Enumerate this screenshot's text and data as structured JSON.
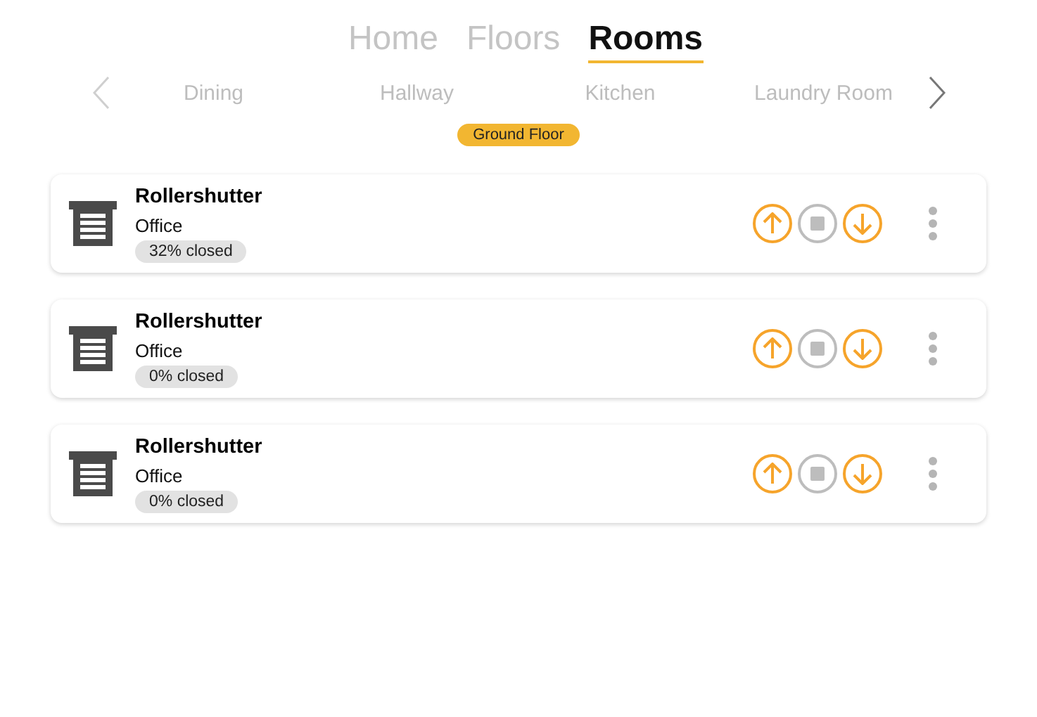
{
  "nav_tabs": [
    {
      "label": "Home",
      "selected": false
    },
    {
      "label": "Floors",
      "selected": false
    },
    {
      "label": "Rooms",
      "selected": true
    }
  ],
  "room_carousel": {
    "prev_disabled": true,
    "next_disabled": false,
    "rooms": [
      "Dining",
      "Hallway",
      "Kitchen",
      "Laundry Room"
    ]
  },
  "floor_badge": "Ground Floor",
  "devices": [
    {
      "name": "Rollershutter",
      "room": "Office",
      "status": "32% closed",
      "controls": [
        {
          "kind": "up",
          "disabled": false
        },
        {
          "kind": "stop",
          "disabled": true
        },
        {
          "kind": "down",
          "disabled": false
        }
      ]
    },
    {
      "name": "Rollershutter",
      "room": "Office",
      "status": "0% closed",
      "controls": [
        {
          "kind": "up",
          "disabled": false
        },
        {
          "kind": "stop",
          "disabled": true
        },
        {
          "kind": "down",
          "disabled": false
        }
      ]
    },
    {
      "name": "Rollershutter",
      "room": "Office",
      "status": "0% closed",
      "controls": [
        {
          "kind": "up",
          "disabled": false
        },
        {
          "kind": "stop",
          "disabled": true
        },
        {
          "kind": "down",
          "disabled": false
        }
      ]
    }
  ]
}
